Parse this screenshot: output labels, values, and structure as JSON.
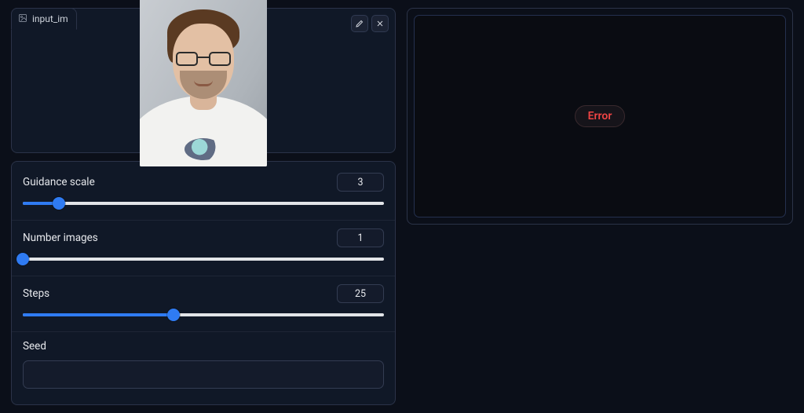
{
  "input_image": {
    "tab_label": "input_im"
  },
  "controls": {
    "guidance": {
      "label": "Guidance scale",
      "value": 3,
      "min": 0,
      "max": 30
    },
    "num_images": {
      "label": "Number images",
      "value": 1,
      "min": 1,
      "max": 50
    },
    "steps": {
      "label": "Steps",
      "value": 25,
      "min": 0,
      "max": 60
    },
    "seed": {
      "label": "Seed"
    }
  },
  "output": {
    "status": "Error"
  }
}
